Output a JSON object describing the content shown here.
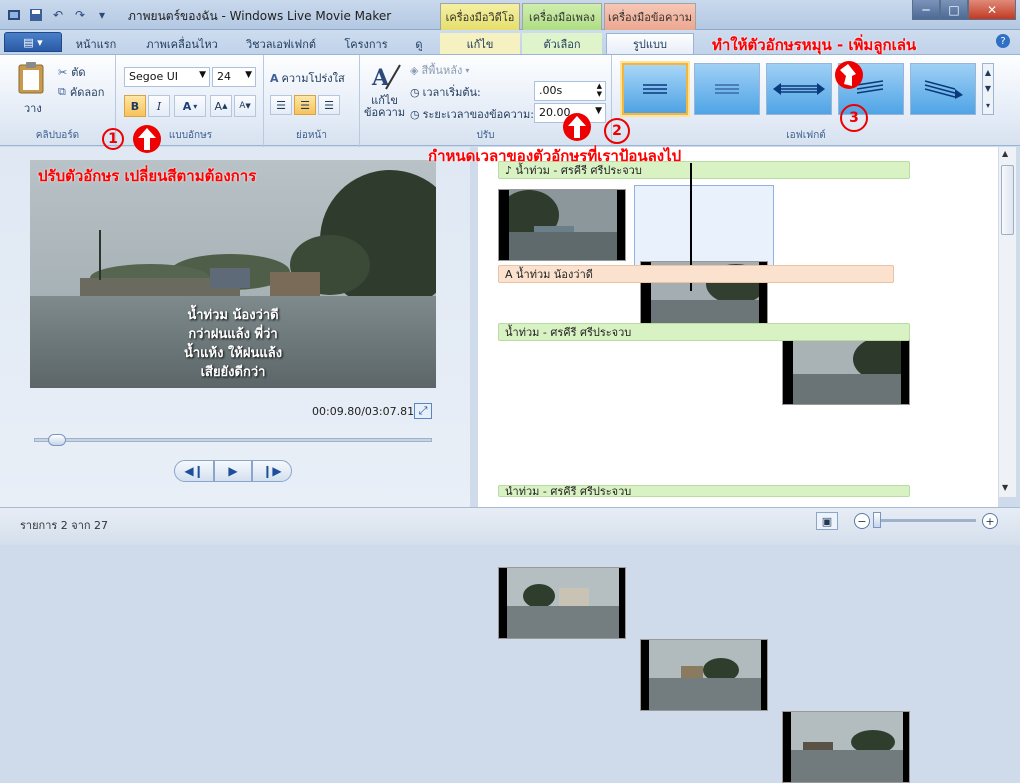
{
  "window": {
    "title": "ภาพยนตร์ของฉัน - Windows Live Movie Maker",
    "minimize": "─",
    "maximize": "□",
    "close": "✕"
  },
  "context_tabs": {
    "video_tools": "เครื่องมือวิดีโอ",
    "music_tools": "เครื่องมือเพลง",
    "text_tools": "เครื่องมือข้อความ"
  },
  "tabs": {
    "app_menu": "▤ ▾",
    "home": "หน้าแรก",
    "animations": "ภาพเคลื่อนไหว",
    "visual_effects": "วิชวลเอฟเฟกต์",
    "project": "โครงการ",
    "view": "ดู",
    "edit": "แก้ไข",
    "options": "ตัวเลือก",
    "format": "รูปแบบ",
    "help": "?"
  },
  "ribbon": {
    "clipboard": {
      "paste": "วาง",
      "cut": "ตัด",
      "copy": "คัดลอก",
      "group": "คลิปบอร์ด"
    },
    "font": {
      "family": "Segoe UI",
      "size": "24",
      "transparency": "ความโปร่งใส",
      "bold": "B",
      "italic": "I",
      "color": "A",
      "grow": "A",
      "shrink": "A",
      "group": "แบบอักษร"
    },
    "paragraph": {
      "group": "ย่อหน้า"
    },
    "adjust": {
      "edit_text": "แก้ไข\nข้อความ",
      "background_color": "สีพื้นหลัง",
      "start_time_label": "เวลาเริ่มต้น:",
      "start_time_value": ".00s",
      "duration_label": "ระยะเวลาของข้อความ:",
      "duration_value": "20.00",
      "group": "ปรับ"
    },
    "effects": {
      "group": "เอฟเฟกต์"
    }
  },
  "annotations": {
    "rotate_hint": "ทำให้ตัวอักษรหมุน - เพิ่มลูกเล่น",
    "font_hint": "ปรับตัวอักษร เปลี่ยนสีตามต้องการ",
    "time_hint": "กำหนดเวลาของตัวอักษรที่เราป้อนลงไป",
    "n1": "1",
    "n2": "2",
    "n3": "3"
  },
  "preview": {
    "caption_lines": [
      "น้ำท่วม น้องว่าดี",
      "กว่าฝนแล้ง พี่ว่า",
      "น้ำแห้ง ให้ฝนแล้ง",
      "เสียยังดีกว่า"
    ],
    "time": "00:09.80/03:07.81"
  },
  "storyboard": {
    "clip1_music": "♪ น้ำท่วม - ศรคีรี ศรีประจวบ",
    "clip1_caption": "A น้ำท่วม น้องว่าดี",
    "clip2_music": "น้ำท่วม - ศรคีรี ศรีประจวบ",
    "clip3_music": "น้ำท่วม - ศรคีรี ศรีประจวบ"
  },
  "status": {
    "items": "รายการ 2 จาก 27"
  }
}
